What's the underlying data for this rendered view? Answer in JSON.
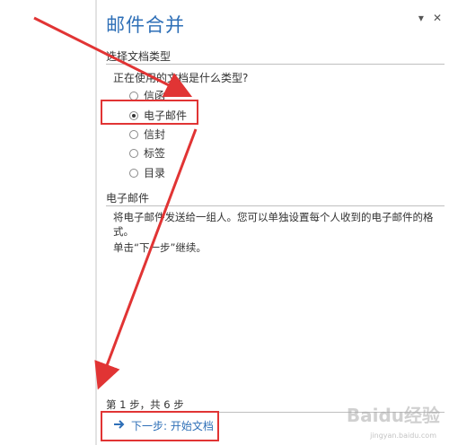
{
  "pane": {
    "title": "邮件合并",
    "controls": {
      "dropdown": "▾",
      "close": "✕"
    }
  },
  "doc_type_section": {
    "label": "选择文档类型",
    "question": "正在使用的文档是什么类型?",
    "options": [
      {
        "label": "信函",
        "selected": false
      },
      {
        "label": "电子邮件",
        "selected": true
      },
      {
        "label": "信封",
        "selected": false
      },
      {
        "label": "标签",
        "selected": false
      },
      {
        "label": "目录",
        "selected": false
      }
    ]
  },
  "description_section": {
    "label": "电子邮件",
    "text": "将电子邮件发送给一组人。您可以单独设置每个人收到的电子邮件的格式。",
    "hint": "单击“下一步”继续。"
  },
  "footer": {
    "step_info": "第 1 步，共 6 步",
    "next_label": "下一步: 开始文档"
  },
  "watermark": {
    "text": "Baidu经验",
    "sub": "jingyan.baidu.com"
  },
  "colors": {
    "accent": "#2e6fb7",
    "annotation": "#e13434"
  }
}
